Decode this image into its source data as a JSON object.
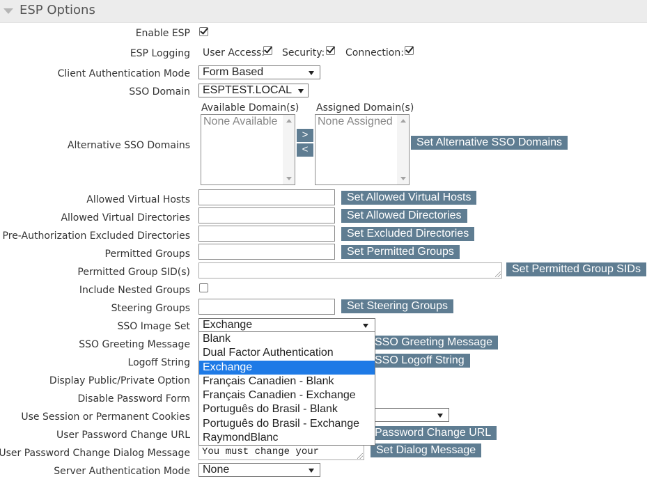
{
  "section": {
    "title": "ESP Options",
    "collapse_icon": "triangle-down-icon"
  },
  "labels": {
    "enable_esp": "Enable ESP",
    "esp_logging": "ESP Logging",
    "client_auth_mode": "Client Authentication Mode",
    "sso_domain": "SSO Domain",
    "alt_sso_domains": "Alternative SSO Domains",
    "allowed_virtual_hosts": "Allowed Virtual Hosts",
    "allowed_virtual_dirs": "Allowed Virtual Directories",
    "preauth_excluded_dirs": "Pre-Authorization Excluded Directories",
    "permitted_groups": "Permitted Groups",
    "permitted_group_sids": "Permitted Group SID(s)",
    "include_nested_groups": "Include Nested Groups",
    "steering_groups": "Steering Groups",
    "sso_image_set": "SSO Image Set",
    "sso_greeting_message": "SSO Greeting Message",
    "logoff_string": "Logoff String",
    "display_public_private": "Display Public/Private Option",
    "disable_password_form": "Disable Password Form",
    "session_cookies": "Use Session or Permanent Cookies",
    "pw_change_url": "User Password Change URL",
    "pw_change_dialog": "User Password Change Dialog Message",
    "server_auth_mode": "Server Authentication Mode"
  },
  "logging": {
    "user_access": "User Access:",
    "security": "Security:",
    "connection": "Connection:"
  },
  "checkboxes": {
    "enable_esp": true,
    "user_access": true,
    "security": true,
    "connection": true,
    "include_nested_groups": false
  },
  "selects": {
    "client_auth_mode": "Form Based",
    "sso_domain": "ESPTEST.LOCAL",
    "sso_image_set": "Exchange",
    "server_auth_mode": "None"
  },
  "domains": {
    "available_title": "Available Domain(s)",
    "assigned_title": "Assigned Domain(s)",
    "available_empty": "None Available",
    "assigned_empty": "None Assigned",
    "add": ">",
    "remove": "<"
  },
  "buttons": {
    "set_alt_sso_domains": "Set Alternative SSO Domains",
    "set_allowed_virtual_hosts": "Set Allowed Virtual Hosts",
    "set_allowed_dirs": "Set Allowed Directories",
    "set_excluded_dirs": "Set Excluded Directories",
    "set_permitted_groups": "Set Permitted Groups",
    "set_permitted_group_sids": "Set Permitted Group SIDs",
    "set_steering_groups": "Set Steering Groups",
    "set_greeting_partial": "SSO Greeting Message",
    "set_logoff_partial": "SSO Logoff String",
    "set_pw_change_url_partial": "Password Change URL",
    "set_dialog_message": "Set Dialog Message"
  },
  "dialog_message_value": "You must change your",
  "image_set_options": [
    "Blank",
    "Dual Factor Authentication",
    "Exchange",
    "Français Canadien - Blank",
    "Français Canadien - Exchange",
    "Português do Brasil - Blank",
    "Português do Brasil - Exchange",
    "RaymondBlanc"
  ],
  "colors": {
    "button_bg": "#5f7d92",
    "selected_option": "#1e7ae6",
    "header_bg": "#ececec"
  }
}
